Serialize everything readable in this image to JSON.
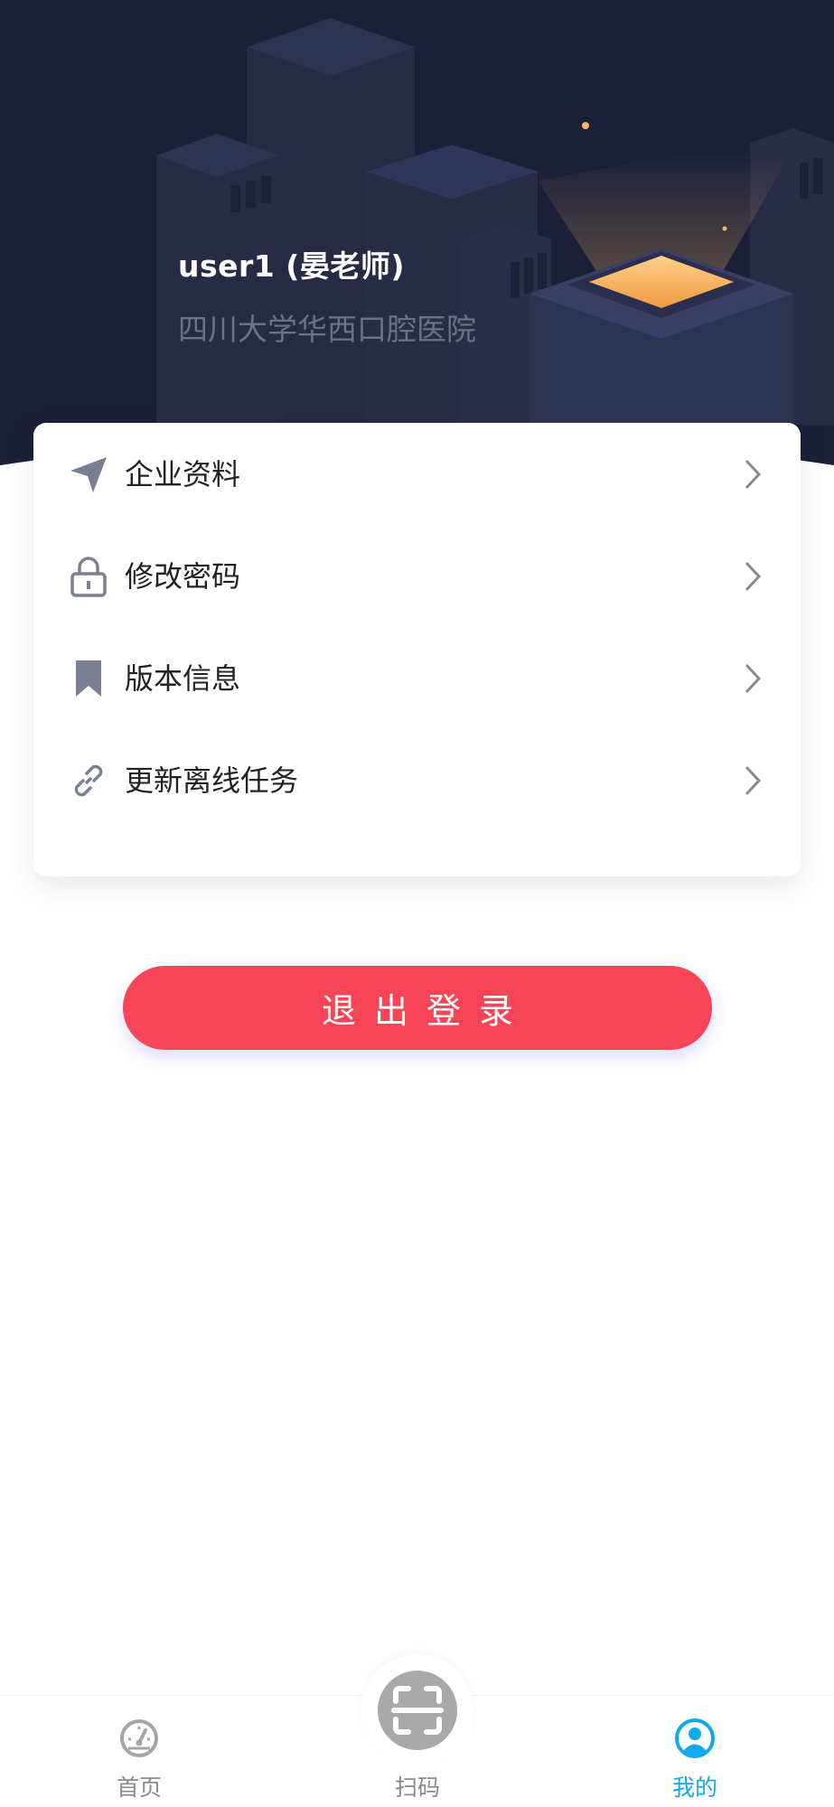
{
  "header": {
    "user_name": "user1 (晏老师)",
    "organization": "四川大学华西口腔医院"
  },
  "menu": {
    "items": [
      {
        "label": "企业资料",
        "icon": "paper-plane-icon"
      },
      {
        "label": "修改密码",
        "icon": "lock-icon"
      },
      {
        "label": "版本信息",
        "icon": "bookmark-icon"
      },
      {
        "label": "更新离线任务",
        "icon": "link-icon"
      }
    ]
  },
  "logout_label": "退出登录",
  "tabbar": {
    "tabs": [
      {
        "label": "首页",
        "icon": "dashboard-icon",
        "active": false
      },
      {
        "label": "扫码",
        "icon": "scan-icon",
        "active": false
      },
      {
        "label": "我的",
        "icon": "user-circle-icon",
        "active": true
      }
    ]
  },
  "colors": {
    "header_bg": "#1b2038",
    "logout": "#f74457",
    "active_tab": "#12a9ea",
    "icon_gray": "#7a7f92"
  }
}
